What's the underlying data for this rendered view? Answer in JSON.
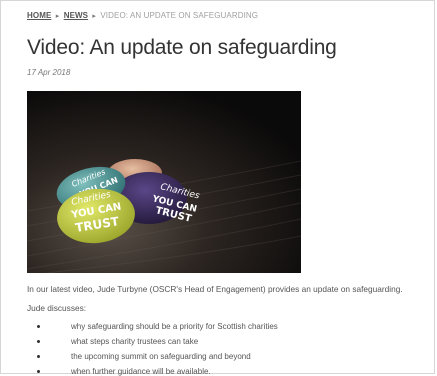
{
  "breadcrumb": {
    "home": "HOME",
    "news": "NEWS",
    "separator": "▸",
    "current": "VIDEO: AN UPDATE ON SAFEGUARDING"
  },
  "article": {
    "title": "Video: An update on safeguarding",
    "date": "17 Apr 2018",
    "image": {
      "badges": [
        {
          "line1": "Charities",
          "line2": "YOU CAN",
          "line3": "TRUST",
          "color": "#c7cf38"
        },
        {
          "line1": "Charities",
          "line2": "YOU CAN",
          "line3": "TRUST",
          "color": "#3b2a5e"
        },
        {
          "line1": "Charities",
          "line2": "YOU CAN",
          "line3": "TRUST",
          "color": "#4f9a9a"
        },
        {
          "color": "#d9a58a"
        }
      ]
    },
    "intro": "In our latest video, Jude Turbyne (OSCR's Head of Engagement) provides an update on safeguarding.",
    "lead": "Jude discusses:",
    "bullets": [
      "why safeguarding should be a priority for Scottish charities",
      "what steps charity trustees can take",
      "the upcoming summit on safeguarding and beyond",
      "when further guidance will be available."
    ]
  },
  "colors": {
    "link": "#555555",
    "muted": "#9a9a9a",
    "title": "#333333",
    "body": "#555555"
  }
}
